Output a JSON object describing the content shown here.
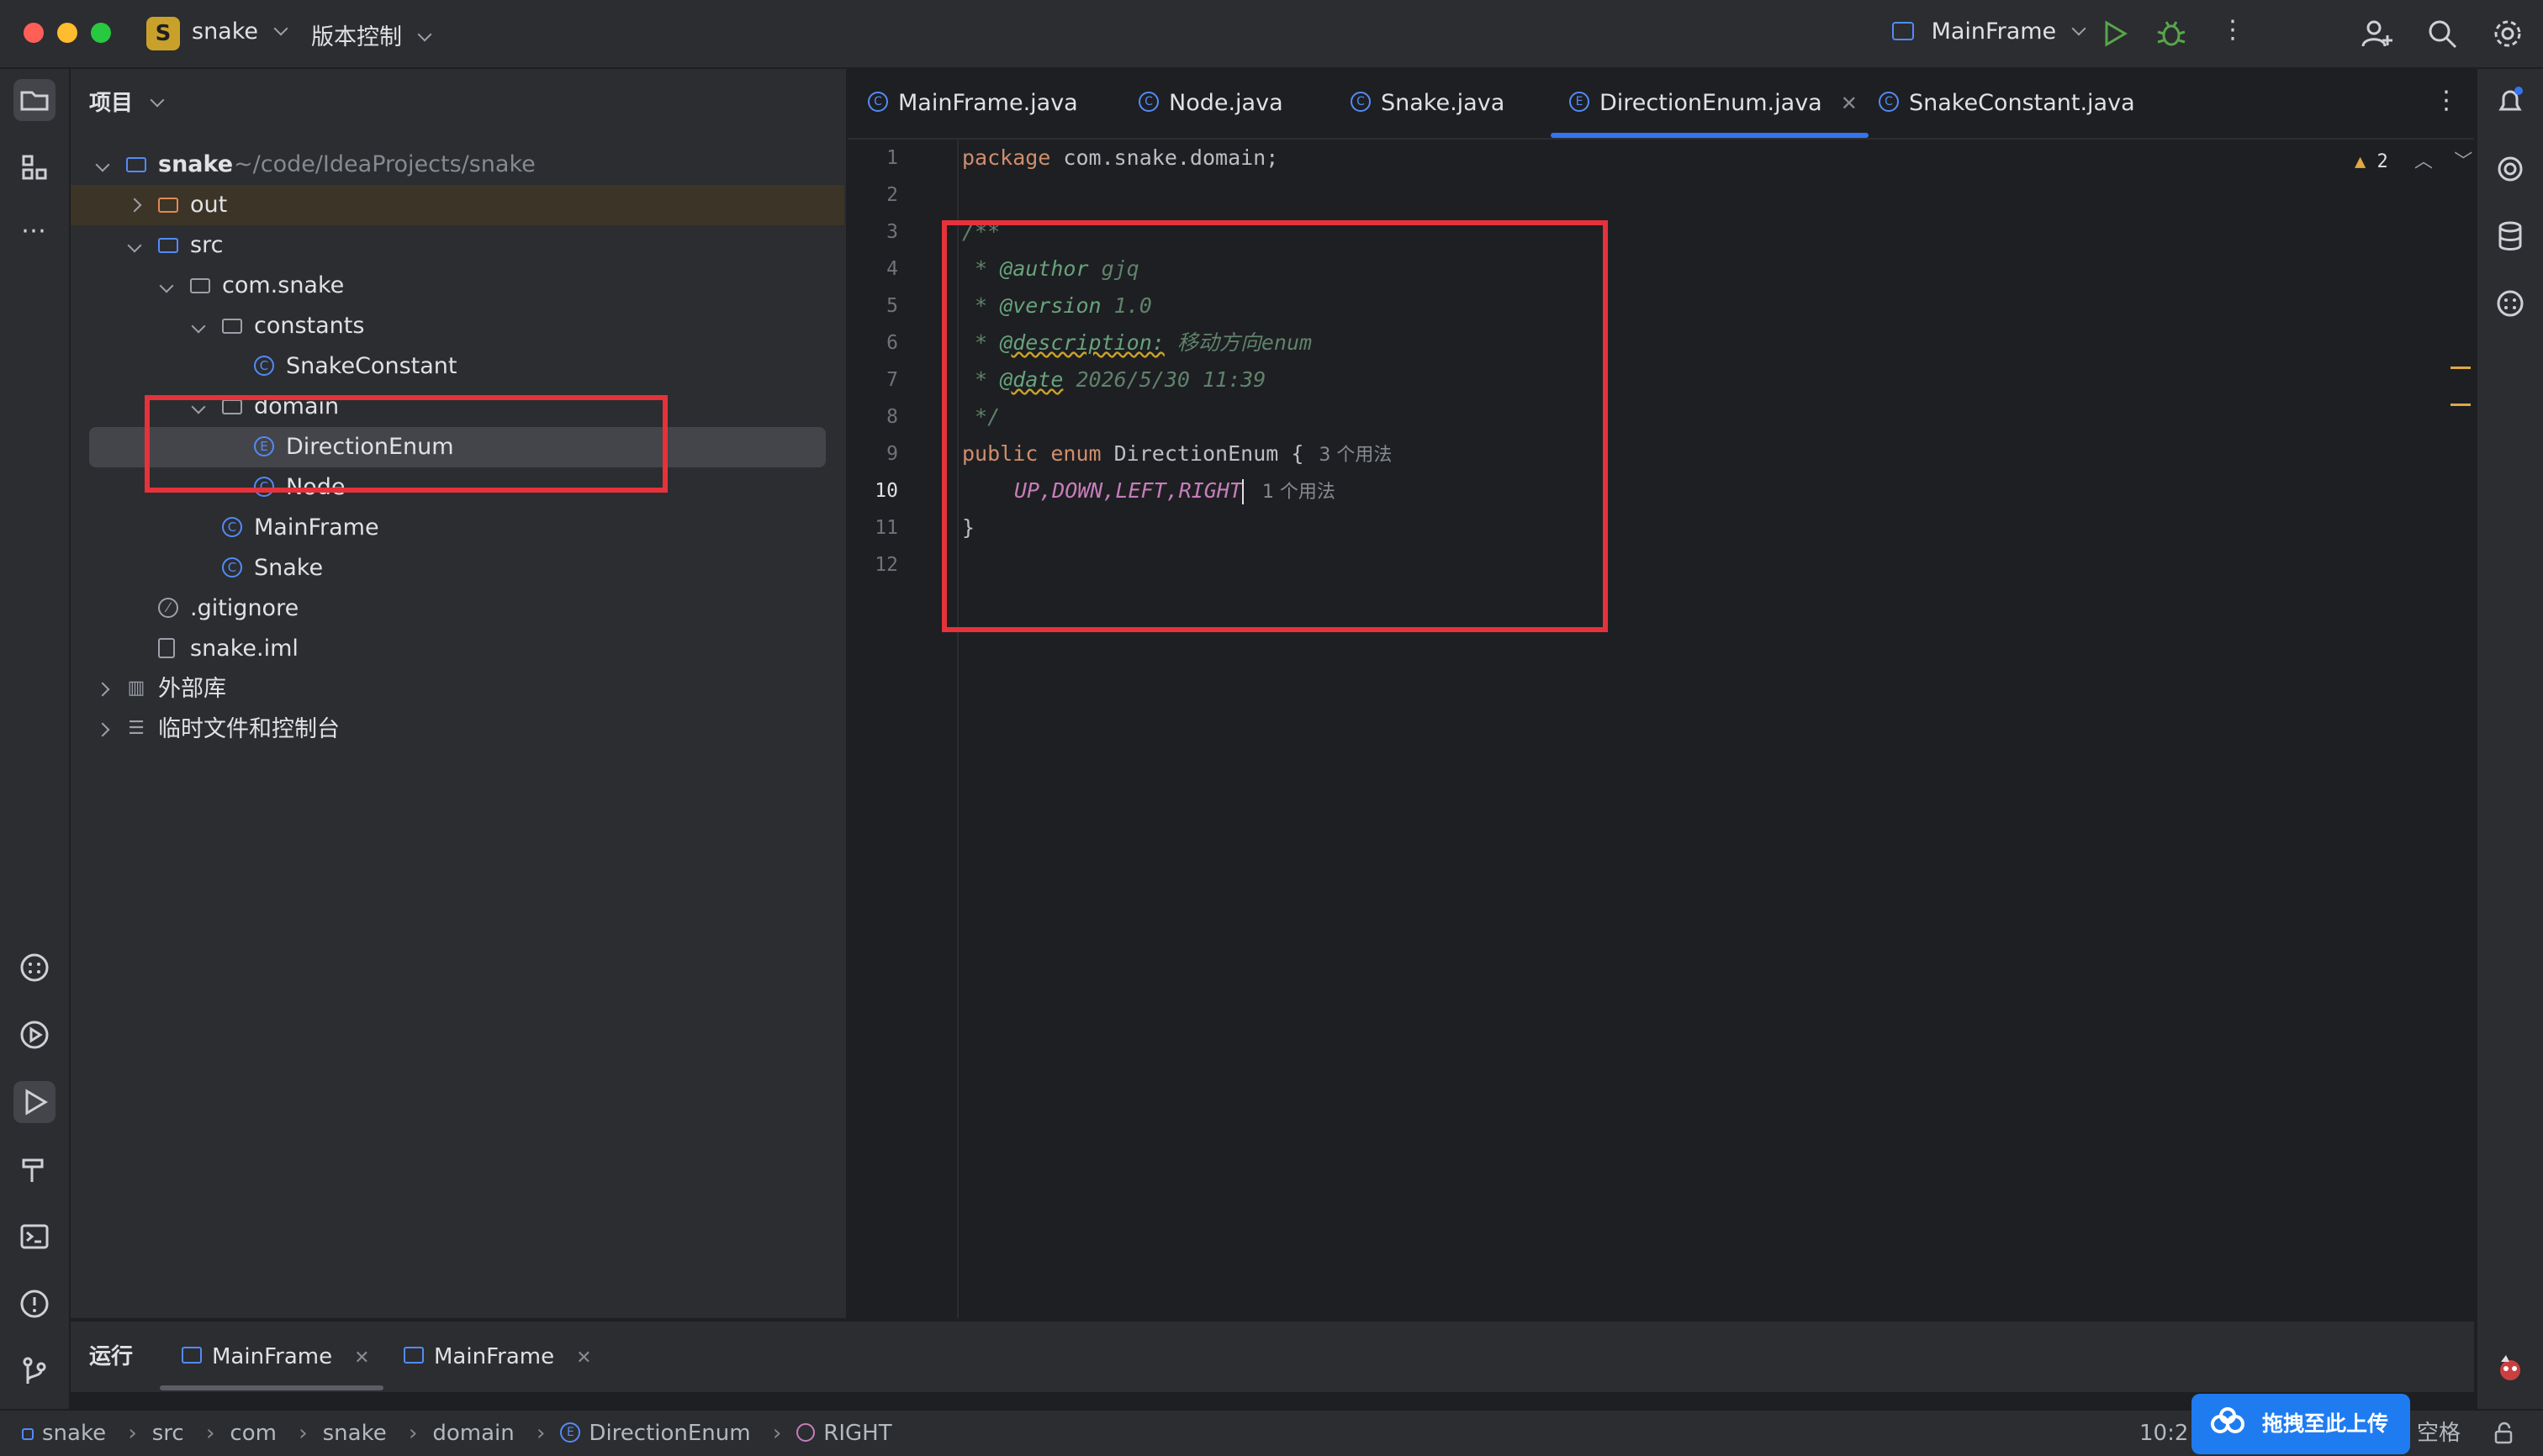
{
  "titlebar": {
    "project_badge": "S",
    "project_name": "snake",
    "vcs_label": "版本控制",
    "run_config": "MainFrame"
  },
  "project_panel": {
    "title": "项目",
    "tree": [
      {
        "label": "snake",
        "path": "~/code/IdeaProjects/snake"
      },
      {
        "label": "out"
      },
      {
        "label": "src"
      },
      {
        "label": "com.snake"
      },
      {
        "label": "constants"
      },
      {
        "label": "SnakeConstant"
      },
      {
        "label": "domain"
      },
      {
        "label": "DirectionEnum"
      },
      {
        "label": "Node"
      },
      {
        "label": "MainFrame"
      },
      {
        "label": "Snake"
      },
      {
        "label": ".gitignore"
      },
      {
        "label": "snake.iml"
      },
      {
        "label": "外部库"
      },
      {
        "label": "临时文件和控制台"
      }
    ]
  },
  "editor": {
    "tabs": [
      {
        "label": "MainFrame.java"
      },
      {
        "label": "Node.java"
      },
      {
        "label": "Snake.java"
      },
      {
        "label": "DirectionEnum.java"
      },
      {
        "label": "SnakeConstant.java"
      }
    ],
    "active_tab": "DirectionEnum.java",
    "warnings_count": "2",
    "line_numbers": [
      "1",
      "2",
      "3",
      "4",
      "5",
      "6",
      "7",
      "8",
      "9",
      "10",
      "11",
      "12"
    ],
    "code": {
      "l1_kw": "package",
      "l1_rest": " com.snake.domain;",
      "l3": "/**",
      "l4_prefix": " * ",
      "l4_tag": "@author",
      "l4_val": " gjq",
      "l5_prefix": " * ",
      "l5_tag": "@version",
      "l5_val": " 1.0",
      "l6_prefix": " * ",
      "l6_tag": "@description:",
      "l6_val": " 移动方向enum",
      "l7_prefix": " * ",
      "l7_tag": "@date",
      "l7_val": " 2026/5/30 11:39",
      "l8": " */",
      "l9_kw": "public enum",
      "l9_rest": " DirectionEnum {",
      "l9_hint": "3 个用法",
      "l10_enum": "UP,DOWN,LEFT,RIGHT",
      "l10_hint": "1 个用法",
      "l11": "}"
    }
  },
  "run_panel": {
    "title": "运行",
    "tabs": [
      "MainFrame",
      "MainFrame"
    ]
  },
  "statusbar": {
    "breadcrumbs": [
      "snake",
      "src",
      "com",
      "snake",
      "domain",
      "DirectionEnum",
      "RIGHT"
    ],
    "time_partial": "10:2",
    "indent_partial": "空格"
  },
  "overlay": {
    "upload_label": "拖拽至此上传"
  },
  "colors": {
    "accent": "#3574f0",
    "highlight_box": "#e5323b",
    "keyword": "#cf8e6d",
    "doc_comment": "#5f826b",
    "enum_constant": "#c77dbb"
  }
}
